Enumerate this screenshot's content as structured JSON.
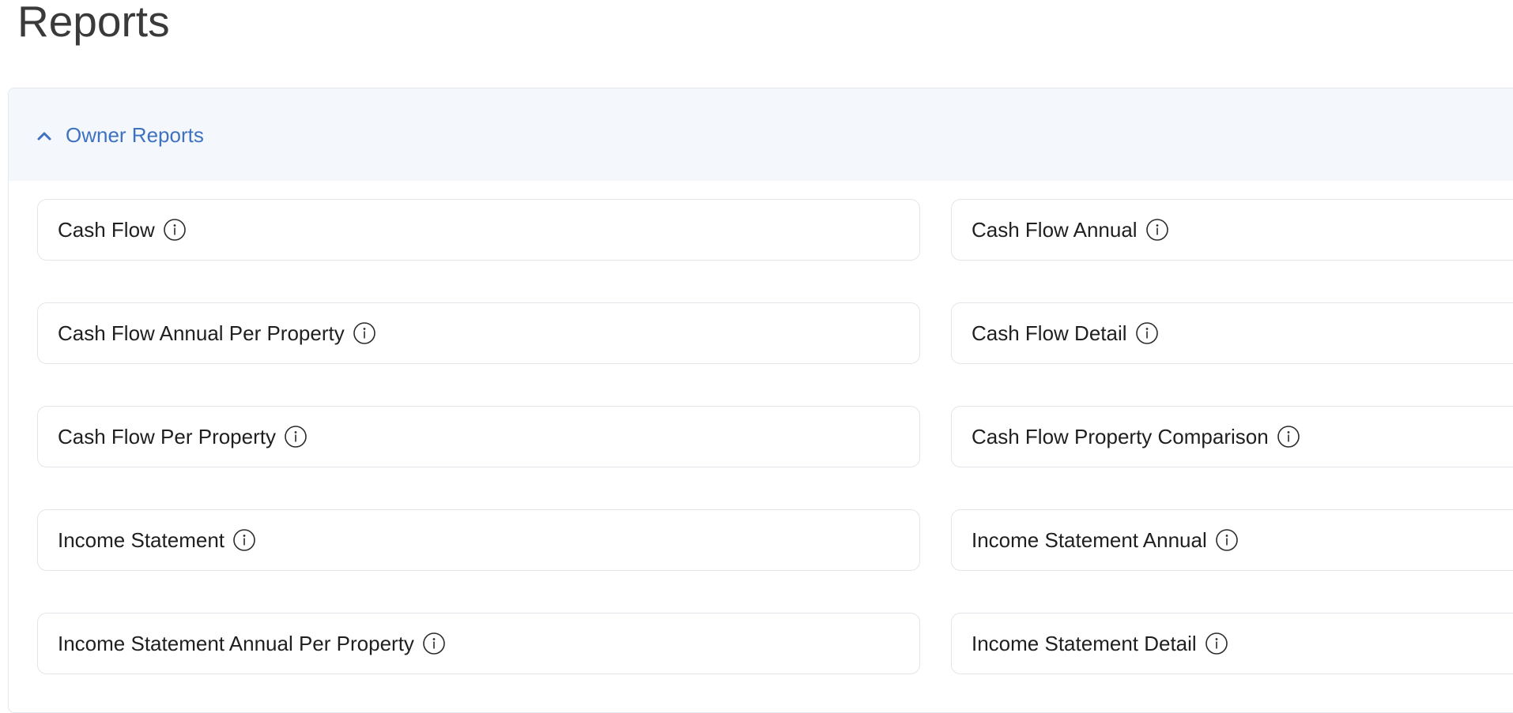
{
  "page": {
    "title": "Reports"
  },
  "section": {
    "title": "Owner Reports",
    "expanded": true,
    "toggle_icon": "chevron-up-icon",
    "accent_color": "#3e72c0",
    "header_bg": "#f4f7fb"
  },
  "reports": [
    {
      "label": "Cash Flow",
      "icon": "info-icon"
    },
    {
      "label": "Cash Flow Annual",
      "icon": "info-icon"
    },
    {
      "label": "Cash Flow Annual Per Property",
      "icon": "info-icon"
    },
    {
      "label": "Cash Flow Detail",
      "icon": "info-icon"
    },
    {
      "label": "Cash Flow Per Property",
      "icon": "info-icon"
    },
    {
      "label": "Cash Flow Property Comparison",
      "icon": "info-icon"
    },
    {
      "label": "Income Statement",
      "icon": "info-icon"
    },
    {
      "label": "Income Statement Annual",
      "icon": "info-icon"
    },
    {
      "label": "Income Statement Annual Per Property",
      "icon": "info-icon"
    },
    {
      "label": "Income Statement Detail",
      "icon": "info-icon"
    }
  ]
}
